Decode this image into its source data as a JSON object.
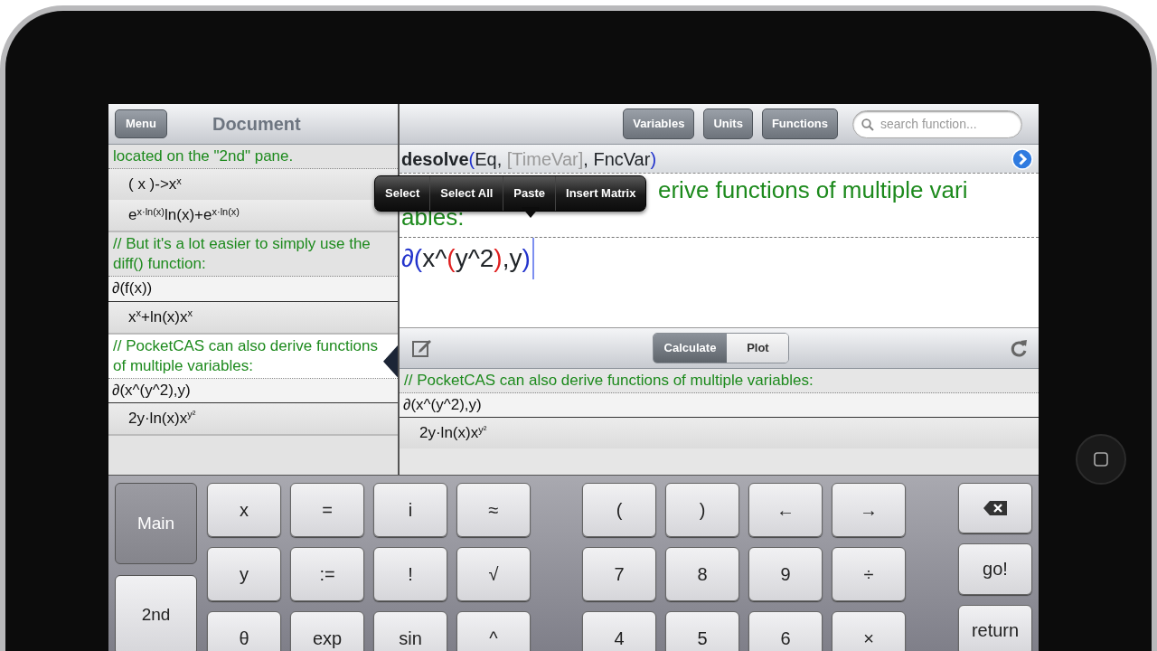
{
  "left_pane": {
    "menu_button": "Menu",
    "title": "Document",
    "cells": [
      {
        "selected": false,
        "lines": [
          {
            "kind": "comment",
            "text": "located on the \"2nd\" pane."
          },
          {
            "kind": "output",
            "text": "( x )->x$^{x}$"
          },
          {
            "kind": "output",
            "text": "e$^{x·ln(x)}$ln(x)+e$^{x·ln(x)}$"
          }
        ]
      },
      {
        "selected": false,
        "lines": [
          {
            "kind": "comment",
            "text": "// But it's a lot easier to simply use the diff() function:"
          },
          {
            "kind": "input",
            "text": "∂(f(x))"
          },
          {
            "kind": "output",
            "text": "x$^{x}$+ln(x)x$^{x}$"
          }
        ]
      },
      {
        "selected": true,
        "lines": [
          {
            "kind": "comment",
            "text": "// PocketCAS can also derive functions of multiple variables:"
          },
          {
            "kind": "input",
            "text": "∂(x^(y^2),y)"
          },
          {
            "kind": "output",
            "text": "2y·ln(x)x$^{y²}$"
          }
        ]
      }
    ]
  },
  "toolbar": {
    "buttons": [
      "Variables",
      "Units",
      "Functions"
    ],
    "search": {
      "placeholder": "search function..."
    }
  },
  "syntax_hint": "desolve(Eq, [TimeVar], FncVar)",
  "editor": {
    "comment_lines": [
      "erive functions of multiple vari",
      "ables:"
    ],
    "input": "∂(x^(y^2),y)"
  },
  "context_menu": [
    "Select",
    "Select All",
    "Paste",
    "Insert Matrix"
  ],
  "mode_tabs": [
    {
      "label": "Calculate",
      "selected": true
    },
    {
      "label": "Plot",
      "selected": false
    }
  ],
  "result": {
    "lines": [
      {
        "kind": "comment",
        "text": "// PocketCAS can also derive functions of multiple variables:"
      },
      {
        "kind": "input",
        "text": "∂(x^(y^2),y)"
      },
      {
        "kind": "output",
        "text": "2y·ln(x)x$^{y²}$"
      }
    ]
  },
  "keyboard": {
    "modes": [
      {
        "label": "Main",
        "selected": true
      },
      {
        "label": "2nd",
        "selected": false
      }
    ],
    "function_keys": [
      "x",
      "=",
      "i",
      "≈",
      "y",
      ":=",
      "!",
      "√",
      "θ",
      "exp",
      "sin",
      "^"
    ],
    "number_keys": [
      "(",
      ")",
      "←",
      "→",
      "7",
      "8",
      "9",
      "÷",
      "4",
      "5",
      "6",
      "×"
    ],
    "action_keys": [
      {
        "kind": "backspace"
      },
      {
        "kind": "text",
        "label": "go!"
      },
      {
        "kind": "text",
        "label": "return"
      }
    ]
  }
}
